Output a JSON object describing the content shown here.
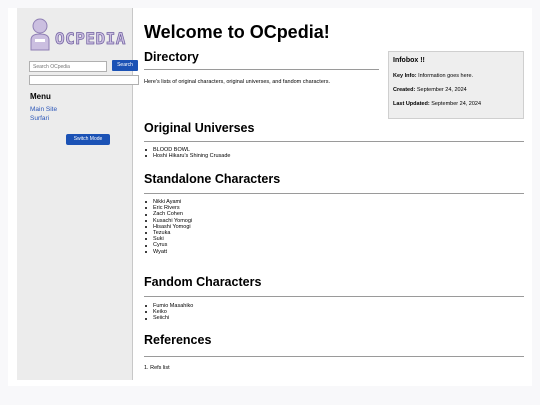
{
  "brand": {
    "logo_text": "OCPEDIA"
  },
  "sidebar": {
    "search_placeholder": "Search OCpedia",
    "search_button": "Search",
    "menu_heading": "Menu",
    "links": [
      "Main Site",
      "Surfari"
    ],
    "switch_mode": "Switch Mode"
  },
  "main": {
    "title": "Welcome to OCpedia!",
    "directory": {
      "heading": "Directory",
      "text": "Here's lists of original characters, original universes, and fandom characters."
    },
    "original_universes": {
      "heading": "Original Universes",
      "items": [
        "BLOOD BOWL",
        "Hoshi Hikaru's Shining Crusade"
      ]
    },
    "standalone_characters": {
      "heading": "Standalone Characters",
      "items": [
        "Nikki Ayami",
        "Eric Rivers",
        "Zach Cohen",
        "Kusachi Yomogi",
        "Hisashi Yomogi",
        "Tezuka",
        "Suki",
        "Cyrus",
        "Wyatt"
      ]
    },
    "fandom_characters": {
      "heading": "Fandom Characters",
      "items": [
        "Fumio Masahiko",
        "Keiko",
        "Seiichi"
      ]
    },
    "references": {
      "heading": "References",
      "items": [
        "1. Refs list"
      ]
    }
  },
  "infobox": {
    "title": "Infobox !!",
    "key_info_label": "Key Info:",
    "key_info_value": "Information goes here.",
    "created_label": "Created:",
    "created_value": "September 24, 2024",
    "updated_label": "Last Updated:",
    "updated_value": "September 24, 2024"
  },
  "colors": {
    "accent": "#1b52b5",
    "link": "#2a55b8",
    "sidebar_bg": "#ececec",
    "logo_fill": "#cbbfe0",
    "logo_stroke": "#8f7fb4"
  }
}
